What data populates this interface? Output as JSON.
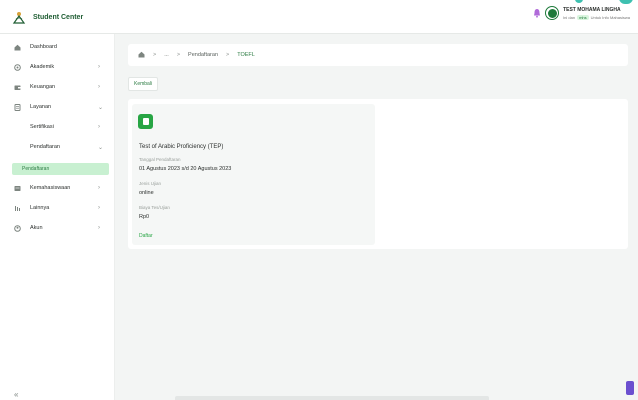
{
  "app": {
    "title": "Student Center"
  },
  "user": {
    "name": "TEST MOHAMA LINGHA",
    "sub_prefix": "Ini dan",
    "role": "mhs",
    "sub_suffix": "Untuk Info Mahasiswa"
  },
  "sidebar": {
    "items": [
      {
        "label": "Dashboard",
        "icon": "home-icon"
      },
      {
        "label": "Akademik",
        "icon": "academic-icon"
      },
      {
        "label": "Keuangan",
        "icon": "wallet-icon"
      },
      {
        "label": "Layanan",
        "icon": "service-icon"
      },
      {
        "label": "Sertifikasi"
      },
      {
        "label": "Pendaftaran"
      },
      {
        "label": "Pendaftaran"
      },
      {
        "label": "Kemahasiswaan",
        "icon": "student-affairs-icon"
      },
      {
        "label": "Lainnya",
        "icon": "more-icon"
      },
      {
        "label": "Akun",
        "icon": "account-icon"
      }
    ],
    "collapse_label": "«"
  },
  "breadcrumb": {
    "ellipsis": "...",
    "parent": "Pendaftaran",
    "current": "TOEFL",
    "separator": ">"
  },
  "back_button": {
    "label": "Kembali"
  },
  "test_card": {
    "title": "Test of Arabic Proficiency (TEP)",
    "date_label": "Tanggal Pendaftaran",
    "date_value": "01 Agustus 2023 s/d 20 Agustus 2023",
    "mode_label": "Jenis Ujian",
    "mode_value": "online",
    "fee_label": "Biaya Tes/Ujian",
    "fee_value": "Rp0",
    "link_label": "Daftar"
  },
  "colors": {
    "primary": "#1e7a3a",
    "accent_light": "#c8f0d1",
    "teal": "#3ec0b0"
  }
}
